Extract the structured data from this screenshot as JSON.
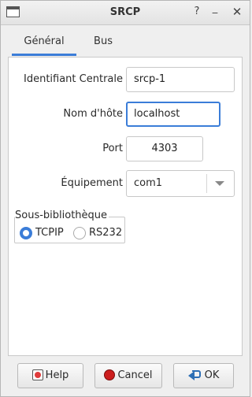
{
  "window": {
    "title": "SRCP",
    "controls": {
      "help": "?",
      "minimize": "_",
      "close": "✕"
    }
  },
  "tabs": [
    {
      "label": "Général",
      "selected": true
    },
    {
      "label": "Bus",
      "selected": false
    }
  ],
  "form": {
    "central_id": {
      "label": "Identifiant Centrale",
      "value": "srcp-1"
    },
    "hostname": {
      "label": "Nom d'hôte",
      "value": "localhost"
    },
    "port": {
      "label": "Port",
      "value": "4303"
    },
    "device": {
      "label": "Équipement",
      "value": "com1"
    }
  },
  "sublibrary": {
    "title": "Sous-bibliothèque",
    "options": [
      {
        "label": "TCPIP",
        "selected": true
      },
      {
        "label": "RS232",
        "selected": false
      }
    ]
  },
  "buttons": {
    "help": "Help",
    "cancel": "Cancel",
    "ok": "OK"
  },
  "colors": {
    "accent": "#3b7dd8",
    "panel": "#ffffff",
    "background": "#efefef"
  },
  "icons": {
    "window": "window-icon",
    "help": "help-icon",
    "cancel": "cancel-icon",
    "ok": "ok-arrow-icon",
    "dropdown": "chevron-down-icon"
  }
}
